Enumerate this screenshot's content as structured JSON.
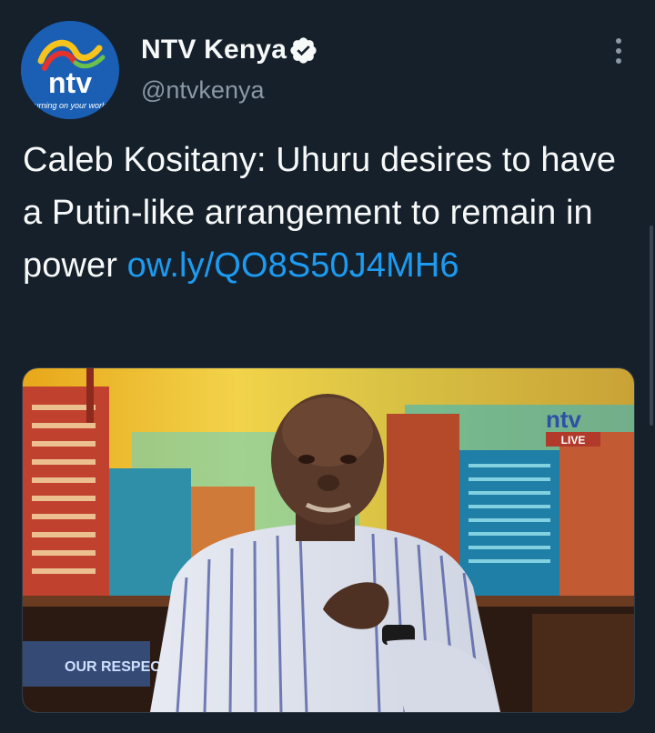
{
  "author": {
    "display_name": "NTV Kenya",
    "handle": "@ntvkenya",
    "avatar": {
      "logo_text": "ntv",
      "tagline": "turning on your world"
    },
    "verified_icon": "verified-badge-icon"
  },
  "tweet": {
    "text": "Caleb Kositany: Uhuru desires to have a Putin-like arrangement to remain in power ",
    "link": "ow.ly/QO8S50J4MH6"
  },
  "media": {
    "description_icon": "tv-studio-photo",
    "screen_logo": "ntv",
    "screen_live": "LIVE",
    "lower_banner": "OUR RESPECT"
  },
  "menu_icon": "more-options-icon",
  "colors": {
    "background": "#15202b",
    "text": "#f7f9f9",
    "secondary": "#8b98a5",
    "link": "#1d9bf0",
    "verified": "#f7f9f9"
  }
}
